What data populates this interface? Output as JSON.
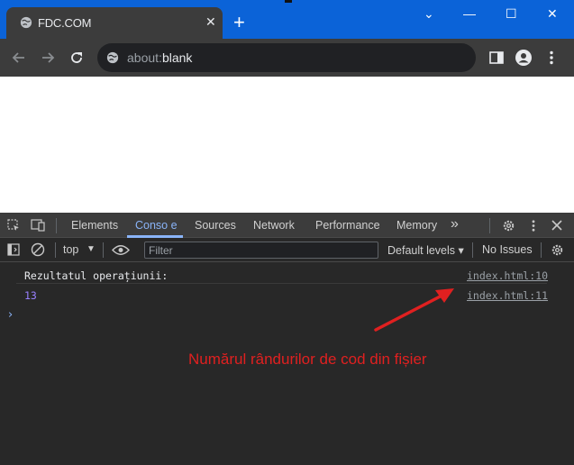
{
  "browser": {
    "tab_title": "FDC.COM",
    "tab_close": "✕",
    "new_tab": "+",
    "window_controls": [
      "⌄",
      "—",
      "☐",
      "✕"
    ],
    "address": {
      "prefix": "about:",
      "host": "blank"
    }
  },
  "devtools": {
    "tabs": [
      "Elements",
      "Conso e",
      "Sources",
      "Network",
      "Performance",
      "Memory"
    ],
    "more_tabs": "»",
    "toolbar": {
      "context": "top",
      "filter_placeholder": "Filter",
      "levels": "Default levels ▾",
      "issues": "No Issues"
    },
    "console": [
      {
        "text": "Rezultatul operațiunii:",
        "source": "index.html:10"
      },
      {
        "text": "13",
        "source": "index.html:11"
      }
    ],
    "prompt": "›"
  },
  "annotation": {
    "text": "Numărul rândurilor de cod din fișier",
    "color": "#e02020"
  },
  "colors": {
    "tabbar": "#0b63d8",
    "toolbar": "#3c3c3c",
    "devtools_bg": "#282828",
    "active_tab": "#8ab4f8",
    "number": "#9980ff"
  }
}
